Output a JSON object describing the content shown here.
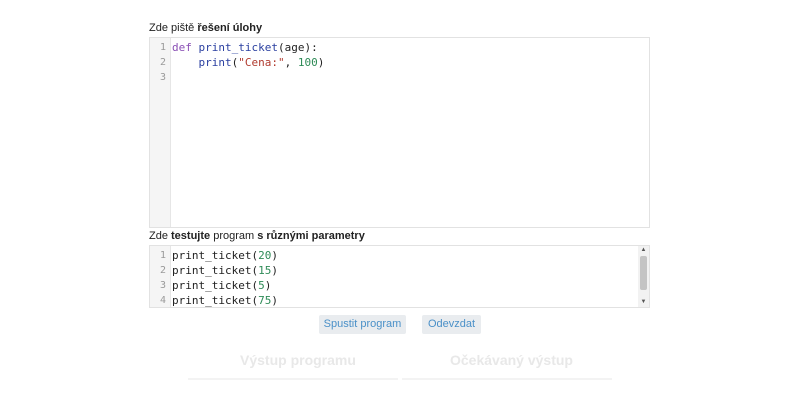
{
  "solution": {
    "label_prefix": "Zde piště ",
    "label_bold": "řešení úlohy",
    "line_numbers": [
      "1",
      "2",
      "3"
    ],
    "code": {
      "l1_kw": "def",
      "l1_fn": "print_ticket",
      "l1_rest": "(age):",
      "l2_indent": "    ",
      "l2_fn": "print",
      "l2_open": "(",
      "l2_str": "\"Cena:\"",
      "l2_sep": ", ",
      "l2_num": "100",
      "l2_close": ")"
    }
  },
  "tests": {
    "label_prefix": "Zde ",
    "label_bold1": "testujte",
    "label_mid": " program ",
    "label_bold2": "s různými parametry",
    "line_numbers": [
      "1",
      "2",
      "3",
      "4"
    ],
    "lines": [
      {
        "fn": "print_ticket",
        "arg": "20"
      },
      {
        "fn": "print_ticket",
        "arg": "15"
      },
      {
        "fn": "print_ticket",
        "arg": "5"
      },
      {
        "fn": "print_ticket",
        "arg": "75"
      }
    ],
    "scroll_up": "▲",
    "scroll_down": "▼"
  },
  "buttons": {
    "run": "Spustit program",
    "submit": "Odevzdat"
  },
  "output": {
    "program_output_title": "Výstup programu",
    "expected_output_title": "Očekávaný výstup"
  },
  "colors": {
    "button_bg": "#e9ecef",
    "button_text": "#4a90c8",
    "keyword": "#8a4fb5",
    "string": "#b03a2e",
    "number": "#2e8b57"
  }
}
